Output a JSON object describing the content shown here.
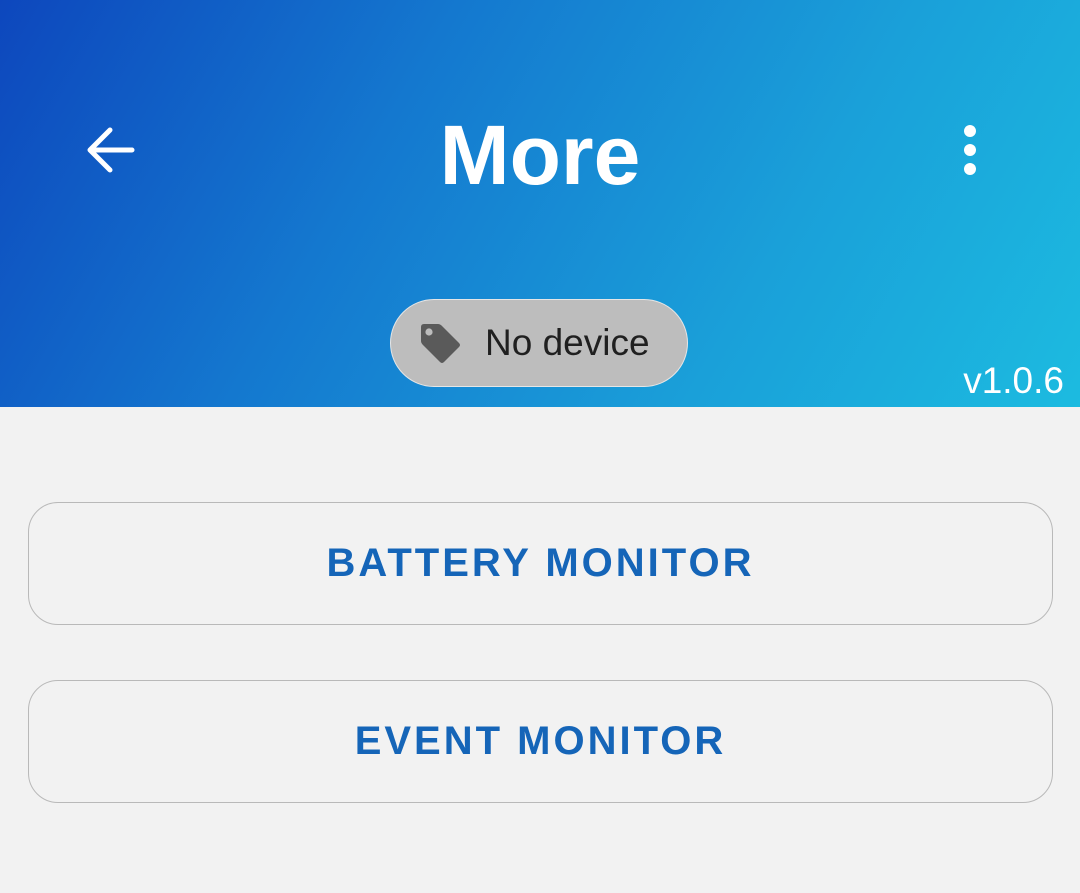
{
  "colors": {
    "header_gradient_start": "#0d47bd",
    "header_gradient_end": "#1cbbe0",
    "chip_bg": "#bdbdbd",
    "button_text": "#1565b8",
    "background": "#f2f2f2"
  },
  "header": {
    "title": "More",
    "back_icon": "arrow-back-icon",
    "menu_icon": "more-vert-icon"
  },
  "device_chip": {
    "icon": "tag-icon",
    "label": "No device"
  },
  "version": "v1.0.6",
  "buttons": [
    {
      "label": "BATTERY MONITOR"
    },
    {
      "label": "EVENT MONITOR"
    }
  ]
}
